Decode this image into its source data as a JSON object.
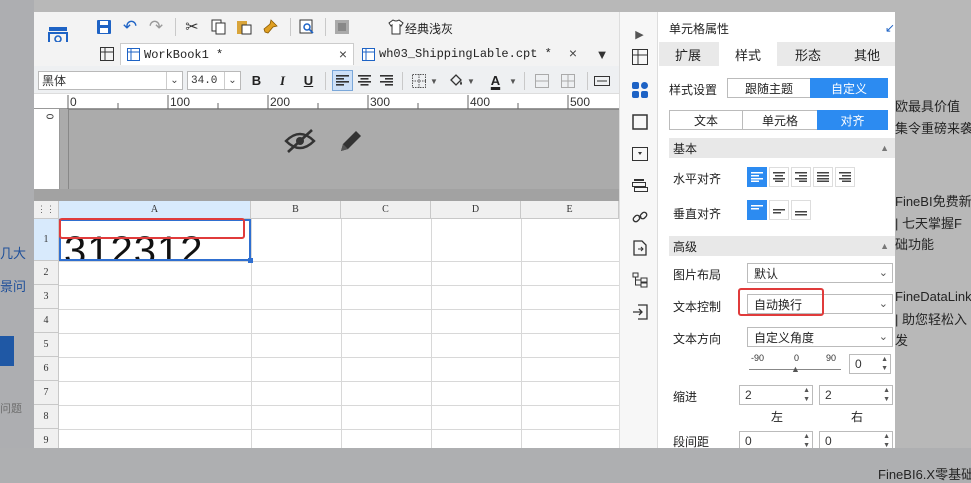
{
  "background": {
    "right_texts": [
      "欧最具价值",
      "集令重磅来袭",
      "FineBI免费新",
      "| 七天掌握F",
      "础功能",
      "FineDataLink",
      "| 助您轻松入",
      "发",
      "FineBI6.X零基础"
    ],
    "left_texts": [
      "几大",
      "景问",
      "问题"
    ]
  },
  "toolbar": {
    "theme_label": "经典浅灰"
  },
  "tabs": [
    {
      "label": "WorkBook1 *",
      "close": "×"
    },
    {
      "label": "wh03_ShippingLable.cpt *",
      "close": "×"
    }
  ],
  "format_bar": {
    "font_family": "黑体",
    "font_size": "34.0",
    "bold": "B",
    "italic": "I",
    "underline": "U",
    "font_color_glyph": "A"
  },
  "ruler": {
    "h_ticks": [
      "0",
      "100",
      "200",
      "300",
      "400",
      "500"
    ],
    "v_ticks": [
      "0"
    ]
  },
  "grid": {
    "columns": [
      "A",
      "B",
      "C",
      "D",
      "E"
    ],
    "rows": [
      "1",
      "2",
      "3",
      "4",
      "5",
      "6",
      "7",
      "8",
      "9"
    ],
    "cell_a1_value": "312312"
  },
  "panel": {
    "title": "单元格属性",
    "tabs": [
      "扩展",
      "样式",
      "形态",
      "其他"
    ],
    "style_setting_label": "样式设置",
    "style_modes": [
      "跟随主题",
      "自定义"
    ],
    "sub_tabs": [
      "文本",
      "单元格",
      "对齐"
    ],
    "basic_section": "基本",
    "h_align_label": "水平对齐",
    "v_align_label": "垂直对齐",
    "advanced_section": "高级",
    "image_layout_label": "图片布局",
    "image_layout_value": "默认",
    "text_control_label": "文本控制",
    "text_control_value": "自动换行",
    "text_direction_label": "文本方向",
    "text_direction_value": "自定义角度",
    "angle_ticks": [
      "-90",
      "0",
      "90"
    ],
    "angle_value": "0",
    "indent_label": "缩进",
    "indent_left_value": "2",
    "indent_right_value": "2",
    "indent_left_caption": "左",
    "indent_right_caption": "右",
    "spacing_label": "段间距",
    "spacing_top_value": "0",
    "spacing_bottom_value": "0"
  }
}
